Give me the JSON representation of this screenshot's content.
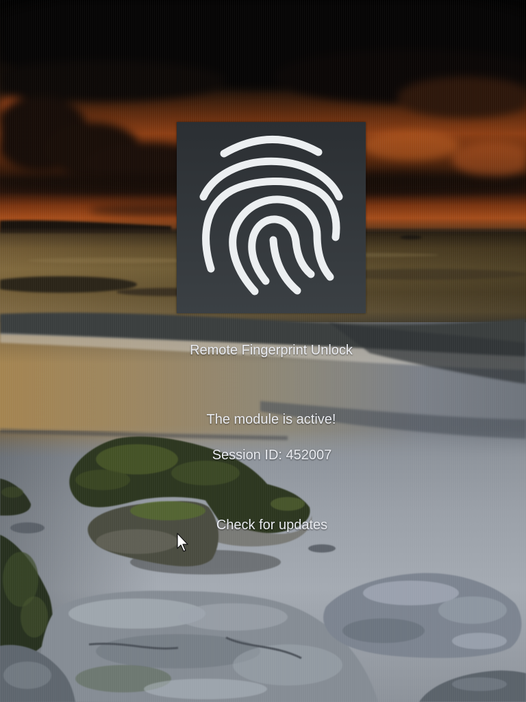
{
  "tile": {
    "icon": "fingerprint-icon",
    "title": "Remote Fingerprint Unlock"
  },
  "status": {
    "message": "The module is active!",
    "session_label": "Session ID:",
    "session_id": "452007"
  },
  "actions": {
    "check_updates": "Check for updates"
  },
  "cursor": {
    "icon": "arrow-cursor-icon"
  },
  "colors": {
    "text": "#e9ebf0",
    "tile_top": "#2b2f33",
    "tile_bottom": "#3b4044",
    "icon": "#eceff1"
  }
}
